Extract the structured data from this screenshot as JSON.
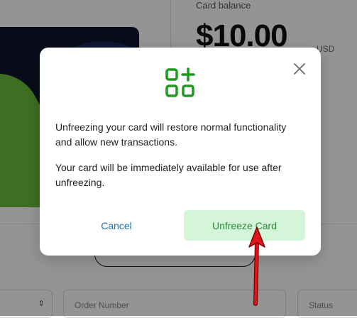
{
  "background": {
    "balance_label": "Card balance",
    "balance_value": "$10.00",
    "balance_currency": "USD",
    "filters": {
      "order_number_placeholder": "Order Number",
      "status_placeholder": "Status"
    }
  },
  "modal": {
    "icon": "apps-plus-icon",
    "message_1": "Unfreezing your card will restore normal functionality and allow new transactions.",
    "message_2": "Your card will be immediately available for use after unfreezing.",
    "cancel_label": "Cancel",
    "confirm_label": "Unfreeze Card",
    "close_icon": "close-icon"
  },
  "colors": {
    "accent_green": "#1b9a1b",
    "confirm_bg": "#d4f5d7",
    "confirm_text": "#2e8b3c",
    "cancel_text": "#1f6fa8",
    "annotation_arrow": "#e0161b"
  }
}
